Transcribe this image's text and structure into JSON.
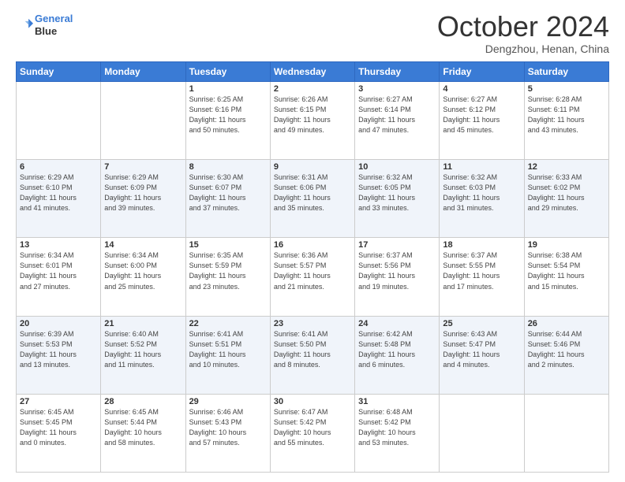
{
  "header": {
    "logo_line1": "General",
    "logo_line2": "Blue",
    "month_title": "October 2024",
    "location": "Dengzhou, Henan, China"
  },
  "weekdays": [
    "Sunday",
    "Monday",
    "Tuesday",
    "Wednesday",
    "Thursday",
    "Friday",
    "Saturday"
  ],
  "weeks": [
    [
      {
        "day": "",
        "info": ""
      },
      {
        "day": "",
        "info": ""
      },
      {
        "day": "1",
        "info": "Sunrise: 6:25 AM\nSunset: 6:16 PM\nDaylight: 11 hours\nand 50 minutes."
      },
      {
        "day": "2",
        "info": "Sunrise: 6:26 AM\nSunset: 6:15 PM\nDaylight: 11 hours\nand 49 minutes."
      },
      {
        "day": "3",
        "info": "Sunrise: 6:27 AM\nSunset: 6:14 PM\nDaylight: 11 hours\nand 47 minutes."
      },
      {
        "day": "4",
        "info": "Sunrise: 6:27 AM\nSunset: 6:12 PM\nDaylight: 11 hours\nand 45 minutes."
      },
      {
        "day": "5",
        "info": "Sunrise: 6:28 AM\nSunset: 6:11 PM\nDaylight: 11 hours\nand 43 minutes."
      }
    ],
    [
      {
        "day": "6",
        "info": "Sunrise: 6:29 AM\nSunset: 6:10 PM\nDaylight: 11 hours\nand 41 minutes."
      },
      {
        "day": "7",
        "info": "Sunrise: 6:29 AM\nSunset: 6:09 PM\nDaylight: 11 hours\nand 39 minutes."
      },
      {
        "day": "8",
        "info": "Sunrise: 6:30 AM\nSunset: 6:07 PM\nDaylight: 11 hours\nand 37 minutes."
      },
      {
        "day": "9",
        "info": "Sunrise: 6:31 AM\nSunset: 6:06 PM\nDaylight: 11 hours\nand 35 minutes."
      },
      {
        "day": "10",
        "info": "Sunrise: 6:32 AM\nSunset: 6:05 PM\nDaylight: 11 hours\nand 33 minutes."
      },
      {
        "day": "11",
        "info": "Sunrise: 6:32 AM\nSunset: 6:03 PM\nDaylight: 11 hours\nand 31 minutes."
      },
      {
        "day": "12",
        "info": "Sunrise: 6:33 AM\nSunset: 6:02 PM\nDaylight: 11 hours\nand 29 minutes."
      }
    ],
    [
      {
        "day": "13",
        "info": "Sunrise: 6:34 AM\nSunset: 6:01 PM\nDaylight: 11 hours\nand 27 minutes."
      },
      {
        "day": "14",
        "info": "Sunrise: 6:34 AM\nSunset: 6:00 PM\nDaylight: 11 hours\nand 25 minutes."
      },
      {
        "day": "15",
        "info": "Sunrise: 6:35 AM\nSunset: 5:59 PM\nDaylight: 11 hours\nand 23 minutes."
      },
      {
        "day": "16",
        "info": "Sunrise: 6:36 AM\nSunset: 5:57 PM\nDaylight: 11 hours\nand 21 minutes."
      },
      {
        "day": "17",
        "info": "Sunrise: 6:37 AM\nSunset: 5:56 PM\nDaylight: 11 hours\nand 19 minutes."
      },
      {
        "day": "18",
        "info": "Sunrise: 6:37 AM\nSunset: 5:55 PM\nDaylight: 11 hours\nand 17 minutes."
      },
      {
        "day": "19",
        "info": "Sunrise: 6:38 AM\nSunset: 5:54 PM\nDaylight: 11 hours\nand 15 minutes."
      }
    ],
    [
      {
        "day": "20",
        "info": "Sunrise: 6:39 AM\nSunset: 5:53 PM\nDaylight: 11 hours\nand 13 minutes."
      },
      {
        "day": "21",
        "info": "Sunrise: 6:40 AM\nSunset: 5:52 PM\nDaylight: 11 hours\nand 11 minutes."
      },
      {
        "day": "22",
        "info": "Sunrise: 6:41 AM\nSunset: 5:51 PM\nDaylight: 11 hours\nand 10 minutes."
      },
      {
        "day": "23",
        "info": "Sunrise: 6:41 AM\nSunset: 5:50 PM\nDaylight: 11 hours\nand 8 minutes."
      },
      {
        "day": "24",
        "info": "Sunrise: 6:42 AM\nSunset: 5:48 PM\nDaylight: 11 hours\nand 6 minutes."
      },
      {
        "day": "25",
        "info": "Sunrise: 6:43 AM\nSunset: 5:47 PM\nDaylight: 11 hours\nand 4 minutes."
      },
      {
        "day": "26",
        "info": "Sunrise: 6:44 AM\nSunset: 5:46 PM\nDaylight: 11 hours\nand 2 minutes."
      }
    ],
    [
      {
        "day": "27",
        "info": "Sunrise: 6:45 AM\nSunset: 5:45 PM\nDaylight: 11 hours\nand 0 minutes."
      },
      {
        "day": "28",
        "info": "Sunrise: 6:45 AM\nSunset: 5:44 PM\nDaylight: 10 hours\nand 58 minutes."
      },
      {
        "day": "29",
        "info": "Sunrise: 6:46 AM\nSunset: 5:43 PM\nDaylight: 10 hours\nand 57 minutes."
      },
      {
        "day": "30",
        "info": "Sunrise: 6:47 AM\nSunset: 5:42 PM\nDaylight: 10 hours\nand 55 minutes."
      },
      {
        "day": "31",
        "info": "Sunrise: 6:48 AM\nSunset: 5:42 PM\nDaylight: 10 hours\nand 53 minutes."
      },
      {
        "day": "",
        "info": ""
      },
      {
        "day": "",
        "info": ""
      }
    ]
  ]
}
